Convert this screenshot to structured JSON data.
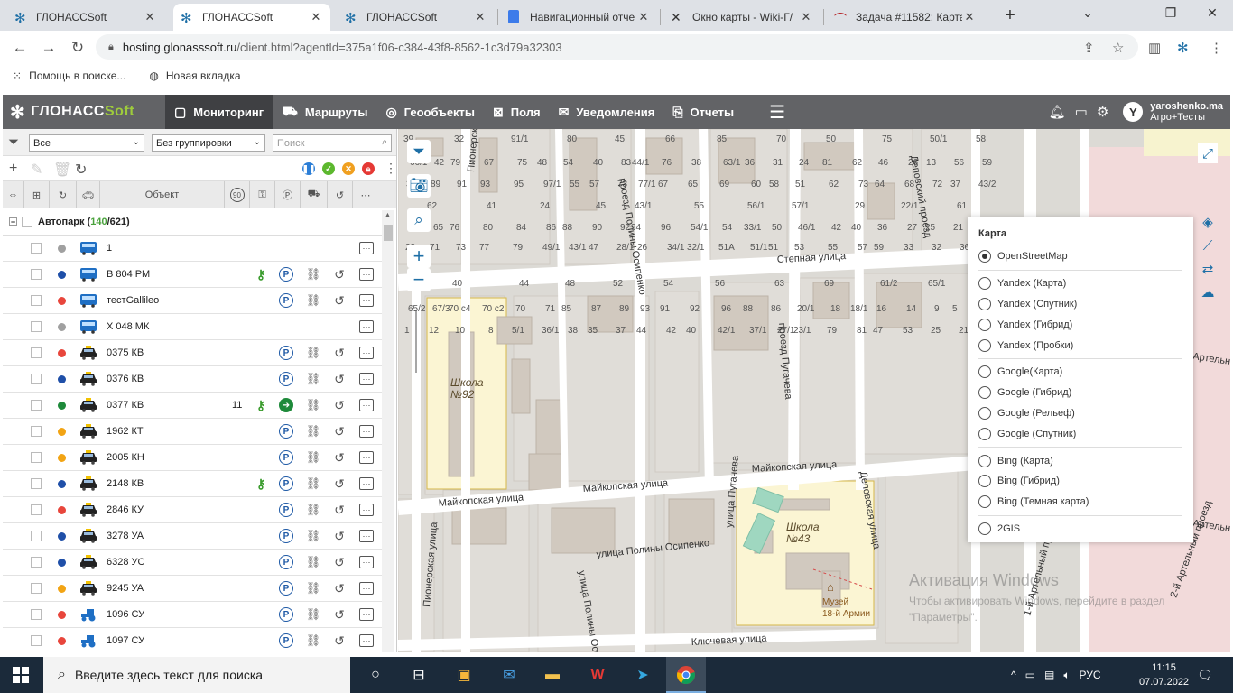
{
  "browser": {
    "tabs": [
      {
        "title": "ГЛОНАССSoft",
        "favicon": "glonass-snowflake",
        "active": false
      },
      {
        "title": "ГЛОНАССSoft",
        "favicon": "glonass-snowflake",
        "active": true
      },
      {
        "title": "ГЛОНАССSoft",
        "favicon": "glonass-snowflake",
        "active": false
      },
      {
        "title": "Навигационный отче",
        "favicon": "docs-icon",
        "active": false
      },
      {
        "title": "Окно карты - Wiki-Г/",
        "favicon": "wiki-icon",
        "active": false
      },
      {
        "title": "Задача #11582: Карта",
        "favicon": "redmine-icon",
        "active": false
      }
    ],
    "url_host": "hosting.glonasssoft.ru",
    "url_rest": "/client.html?agentId=375a1f06-c384-43f8-8562-1c3d79a32303",
    "bookmarks": [
      {
        "label": "Помощь в поиске...",
        "icon": "apps-icon"
      },
      {
        "label": "Новая вкладка",
        "icon": "globe-icon"
      }
    ]
  },
  "app": {
    "logo_main": "ГЛОНАСС",
    "logo_soft": "Soft",
    "nav": [
      {
        "label": "Мониторинг",
        "icon": "monitor-icon",
        "active": true
      },
      {
        "label": "Маршруты",
        "icon": "route-icon",
        "active": false
      },
      {
        "label": "Геообъекты",
        "icon": "geo-icon",
        "active": false
      },
      {
        "label": "Поля",
        "icon": "field-icon",
        "active": false
      },
      {
        "label": "Уведомления",
        "icon": "mail-icon",
        "active": false
      },
      {
        "label": "Отчеты",
        "icon": "report-icon",
        "active": false
      }
    ],
    "user_initial": "Y",
    "user_name": "yaroshenko.ma",
    "user_org": "Агро+Тесты"
  },
  "panel": {
    "filter_all": "Все",
    "grouping": "Без группировки",
    "search_placeholder": "Поиск",
    "col_object": "Объект",
    "col_speed": "90",
    "group_name": "Автопарк (",
    "group_count_active": "140",
    "group_count_total": "/621)",
    "vehicles": [
      {
        "name": "1",
        "status": "#a0a0a0",
        "type": "bus",
        "speed": "",
        "key": false,
        "park": false,
        "move": false,
        "bino": false,
        "hist": false
      },
      {
        "name": "В 804 РМ",
        "status": "#1f4fa8",
        "type": "bus",
        "speed": "",
        "key": true,
        "park": true,
        "move": false,
        "bino": true,
        "hist": true
      },
      {
        "name": "тестGallileo",
        "status": "#e8463c",
        "type": "bus",
        "speed": "",
        "key": false,
        "park": true,
        "move": false,
        "bino": true,
        "hist": true
      },
      {
        "name": "Х 048 МК",
        "status": "#a0a0a0",
        "type": "bus",
        "speed": "",
        "key": false,
        "park": false,
        "move": false,
        "bino": false,
        "hist": false
      },
      {
        "name": "0375 КВ",
        "status": "#e8463c",
        "type": "taxi",
        "speed": "",
        "key": false,
        "park": true,
        "move": false,
        "bino": true,
        "hist": true
      },
      {
        "name": "0376 КВ",
        "status": "#1f4fa8",
        "type": "taxi",
        "speed": "",
        "key": false,
        "park": true,
        "move": false,
        "bino": true,
        "hist": true
      },
      {
        "name": "0377 КВ",
        "status": "#1e8a3a",
        "type": "taxi",
        "speed": "11",
        "key": true,
        "park": false,
        "move": true,
        "bino": true,
        "hist": true
      },
      {
        "name": "1962 КТ",
        "status": "#f2a414",
        "type": "taxi",
        "speed": "",
        "key": false,
        "park": true,
        "move": false,
        "bino": true,
        "hist": true
      },
      {
        "name": "2005 КН",
        "status": "#f2a414",
        "type": "taxi",
        "speed": "",
        "key": false,
        "park": true,
        "move": false,
        "bino": true,
        "hist": true
      },
      {
        "name": "2148 КВ",
        "status": "#1f4fa8",
        "type": "taxi",
        "speed": "",
        "key": true,
        "park": true,
        "move": false,
        "bino": true,
        "hist": true
      },
      {
        "name": "2846 КУ",
        "status": "#e8463c",
        "type": "taxi",
        "speed": "",
        "key": false,
        "park": true,
        "move": false,
        "bino": true,
        "hist": true
      },
      {
        "name": "3278 УА",
        "status": "#1f4fa8",
        "type": "taxi",
        "speed": "",
        "key": false,
        "park": true,
        "move": false,
        "bino": true,
        "hist": true
      },
      {
        "name": "6328 УС",
        "status": "#1f4fa8",
        "type": "taxi",
        "speed": "",
        "key": false,
        "park": true,
        "move": false,
        "bino": true,
        "hist": true
      },
      {
        "name": "9245 УА",
        "status": "#f2a414",
        "type": "taxi",
        "speed": "",
        "key": false,
        "park": true,
        "move": false,
        "bino": true,
        "hist": true
      },
      {
        "name": "1096 СУ",
        "status": "#e8463c",
        "type": "tractor",
        "speed": "",
        "key": false,
        "park": true,
        "move": false,
        "bino": true,
        "hist": true
      },
      {
        "name": "1097 СУ",
        "status": "#e8463c",
        "type": "tractor",
        "speed": "",
        "key": false,
        "park": true,
        "move": false,
        "bino": true,
        "hist": true
      }
    ]
  },
  "map": {
    "streets": [
      "Степная улица",
      "Майкопская улица",
      "Майкопская улица",
      "Майкопская улица",
      "улица Полины Осипенко",
      "Ключевая улица",
      "Пионерский проезд",
      "проезд Полины Осипенко",
      "проезд Пугачева",
      "Деповский проезд",
      "Деповская улица",
      "улица Пугачева",
      "Пионерская улица",
      "улица Полины Осипенко",
      "1-й Артельный проезд",
      "2-й Артельный проезд",
      "Артельн",
      "Артельн"
    ],
    "pois": [
      {
        "name": "Школа\n№92"
      },
      {
        "name": "Школа\n№43"
      },
      {
        "name": "Музей\n18-й Армии"
      }
    ],
    "house_numbers": [
      "39",
      "32",
      "91/1",
      "80",
      "45",
      "66",
      "85",
      "70",
      "50",
      "75",
      "50/1",
      "58",
      "66/1",
      "42",
      "79",
      "67",
      "75",
      "48",
      "54",
      "40",
      "83",
      "44/1",
      "76",
      "38",
      "63/1",
      "36",
      "31",
      "24",
      "81",
      "62",
      "46",
      "26",
      "13",
      "56",
      "59",
      "34",
      "89",
      "91",
      "93",
      "95",
      "97/1",
      "55",
      "57",
      "73",
      "77/1",
      "67",
      "65",
      "69",
      "60",
      "58",
      "51",
      "62",
      "73",
      "64",
      "68",
      "72",
      "37",
      "43/2",
      "62",
      "41",
      "24",
      "45",
      "43/1",
      "55",
      "56/1",
      "57/1",
      "29",
      "22/1",
      "61",
      "63",
      "65",
      "76",
      "80",
      "84",
      "86",
      "88",
      "90",
      "92",
      "94",
      "96",
      "54/1",
      "54",
      "33/1",
      "50",
      "46/1",
      "42",
      "40",
      "36",
      "27",
      "25",
      "21",
      "23",
      "71",
      "73",
      "77",
      "79",
      "49/1",
      "43/1",
      "47",
      "28/1",
      "26",
      "34/1",
      "32/1",
      "51А",
      "51/1",
      "51",
      "53",
      "55",
      "57",
      "59",
      "33",
      "32",
      "36",
      "38",
      "40",
      "44",
      "48",
      "52",
      "54",
      "56",
      "63",
      "69",
      "61/2",
      "65/1",
      "65/2",
      "67/3",
      "70 с4",
      "70 с2",
      "70",
      "71",
      "85",
      "87",
      "89",
      "93",
      "91",
      "92",
      "96",
      "88",
      "86",
      "20/1",
      "18",
      "18/1",
      "16",
      "14",
      "9",
      "5",
      "1",
      "12",
      "10",
      "8",
      "5/1",
      "36/1",
      "38",
      "35",
      "37",
      "44",
      "42",
      "40",
      "42/1",
      "37/1",
      "27/1",
      "23/1",
      "79",
      "81",
      "47",
      "53",
      "25",
      "21"
    ],
    "layer_title": "Карта",
    "layers": [
      {
        "label": "OpenStreetMap",
        "selected": true,
        "group": 0
      },
      {
        "label": "Yandex (Карта)",
        "selected": false,
        "group": 1
      },
      {
        "label": "Yandex (Спутник)",
        "selected": false,
        "group": 1
      },
      {
        "label": "Yandex (Гибрид)",
        "selected": false,
        "group": 1
      },
      {
        "label": "Yandex (Пробки)",
        "selected": false,
        "group": 1
      },
      {
        "label": "Google(Карта)",
        "selected": false,
        "group": 2
      },
      {
        "label": "Google (Гибрид)",
        "selected": false,
        "group": 2
      },
      {
        "label": "Google (Рельеф)",
        "selected": false,
        "group": 2
      },
      {
        "label": "Google (Спутник)",
        "selected": false,
        "group": 2
      },
      {
        "label": "Bing (Карта)",
        "selected": false,
        "group": 3
      },
      {
        "label": "Bing (Гибрид)",
        "selected": false,
        "group": 3
      },
      {
        "label": "Bing (Темная карта)",
        "selected": false,
        "group": 3
      },
      {
        "label": "2GIS",
        "selected": false,
        "group": 4
      }
    ],
    "watermark_title": "Активация Windows",
    "watermark_text": "Чтобы активировать Windows, перейдите в раздел \"Параметры\"."
  },
  "taskbar": {
    "search_placeholder": "Введите здесь текст для поиска",
    "lang": "РУС",
    "time": "11:15",
    "date": "07.07.2022"
  }
}
